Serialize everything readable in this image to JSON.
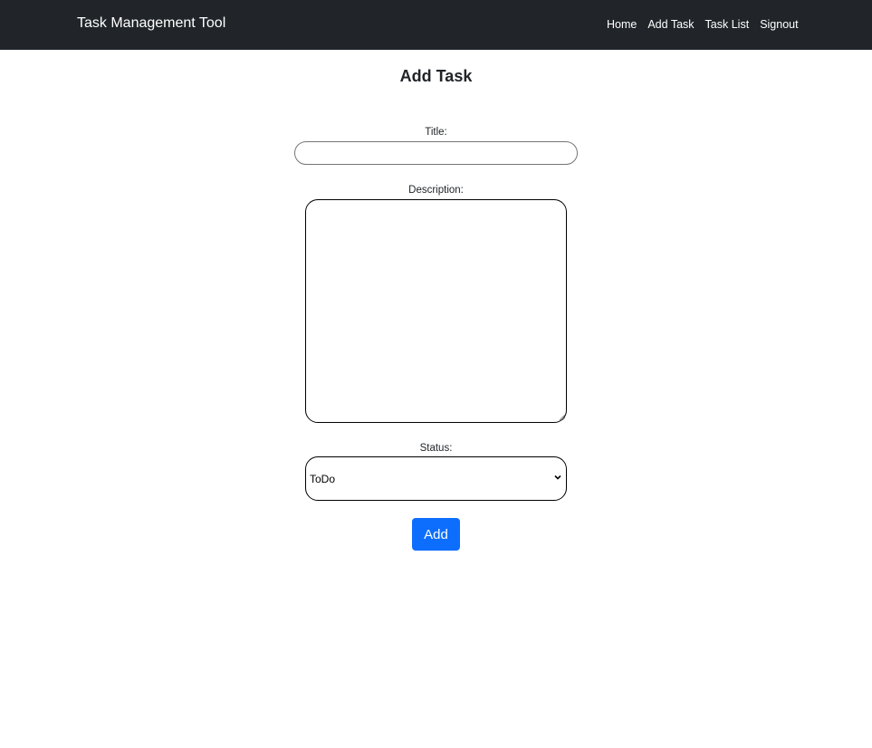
{
  "navbar": {
    "brand": "Task Management Tool",
    "links": [
      "Home",
      "Add Task",
      "Task List",
      "Signout"
    ],
    "background": "#212529"
  },
  "page": {
    "title": "Add Task"
  },
  "form": {
    "title_label": "Title:",
    "title_value": "",
    "description_label": "Description:",
    "description_value": "",
    "status_label": "Status:",
    "status_selected": "ToDo",
    "submit_label": "Add",
    "submit_color": "#0d6efd"
  }
}
